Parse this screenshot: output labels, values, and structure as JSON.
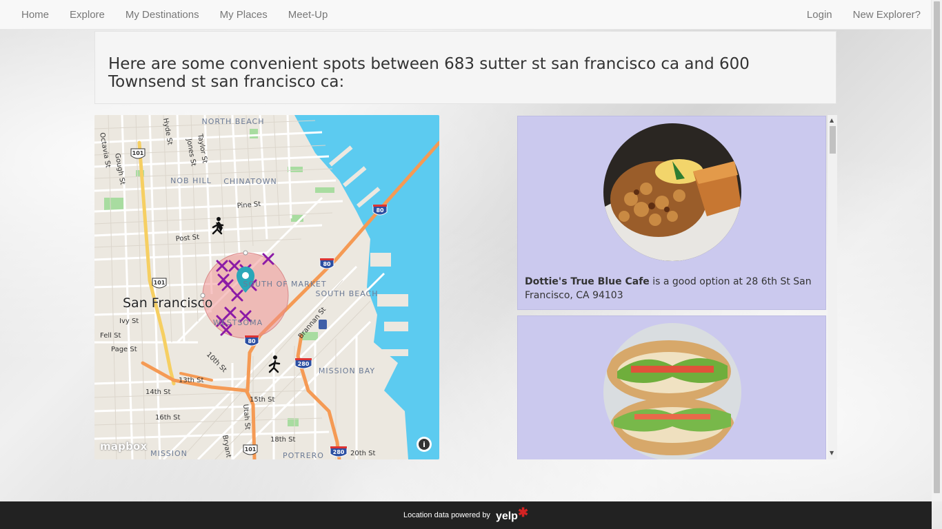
{
  "nav": {
    "left": [
      "Home",
      "Explore",
      "My Destinations",
      "My Places",
      "Meet-Up"
    ],
    "right": [
      "Login",
      "New Explorer?"
    ]
  },
  "heading": "Here are some convenient spots between 683 sutter st san francisco ca and 600 Townsend st san francisco ca:",
  "map": {
    "city_label": "San Francisco",
    "neighborhoods": [
      "NORTH BEACH",
      "NOB HILL",
      "CHINATOWN",
      "SOUTH OF MARKET",
      "SOUTH BEACH",
      "WESTSOMA",
      "MISSION BAY",
      "MISSION",
      "POTRERO"
    ],
    "streets": [
      "Hyde St",
      "Taylor St",
      "Jones St",
      "Octavia St",
      "Gough St",
      "Pine St",
      "Post St",
      "Ivy St",
      "Fell St",
      "Page St",
      "10th St",
      "13th St",
      "14th St",
      "16th St",
      "15th St",
      "Utah St",
      "18th St",
      "20th St",
      "Brannan St",
      "Bryant"
    ],
    "highway_shields": [
      "101",
      "80",
      "80",
      "101",
      "80",
      "280",
      "101",
      "280"
    ],
    "attribution": "mapbox",
    "water_color": "#5ccbf0",
    "marker_color": "#2aa7b8",
    "cross_color": "#8b1aa6"
  },
  "results": [
    {
      "name": "Dottie's True Blue Cafe",
      "text": " is a good option at 28 6th St San Francisco, CA 94103",
      "photo": "breakfast-potatoes-toast"
    },
    {
      "name": "",
      "text": "",
      "photo": "chicken-sandwich"
    }
  ],
  "footer": {
    "text": "Location data powered by",
    "brand": "yelp"
  }
}
